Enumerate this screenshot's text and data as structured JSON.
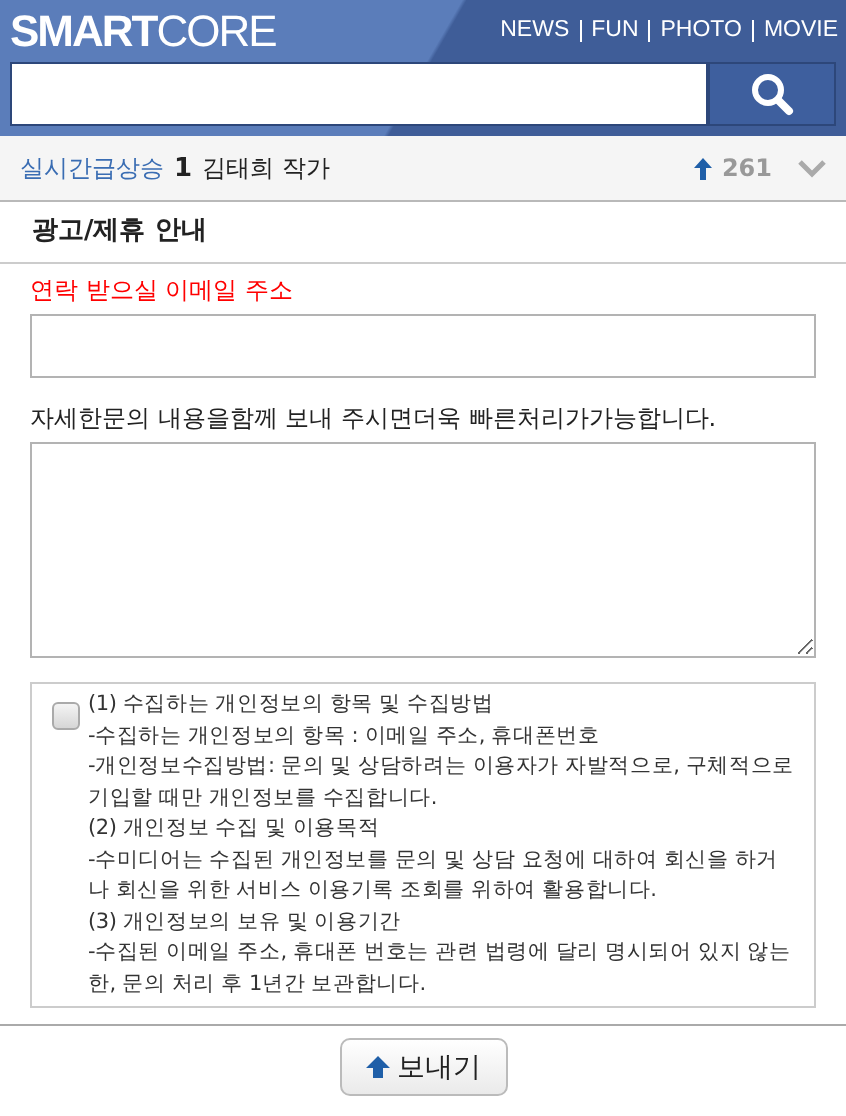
{
  "header": {
    "logo": "**SMART**CORE",
    "nav": [
      "NEWS",
      "FUN",
      "PHOTO",
      "MOVIE"
    ]
  },
  "trending": {
    "label": "실시간급상승",
    "rank": "1",
    "title": "김태희 작가",
    "count": "261"
  },
  "page_title": "광고/제휴 안내",
  "email": {
    "label": "연락 받으실 이메일 주소"
  },
  "message": {
    "label": "자세한문의 내용을함께 보내 주시면더욱 빠른처리가가능합니다."
  },
  "consent": {
    "checked": false,
    "lines": [
      "(1) 수집하는 개인정보의 항목 및 수집방법",
      "-수집하는 개인정보의 항목 : 이메일 주소, 휴대폰번호",
      "-개인정보수집방법: 문의 및 상담하려는 이용자가 자발적으로, 구체적으로 기입할 때만 개인정보를 수집합니다.",
      "(2) 개인정보 수집 및 이용목적",
      "-수미디어는 수집된 개인정보를 문의 및 상담 요청에 대하여 회신을 하거나 회신을 위한 서비스 이용기록 조회를 위하여 활용합니다.",
      "(3) 개인정보의 보유 및 이용기간",
      "-수집된 이메일 주소, 휴대폰 번호는 관련 법령에 달리 명시되어 있지 않는 한, 문의 처리 후 1년간 보관합니다."
    ]
  },
  "submit": "보내기"
}
